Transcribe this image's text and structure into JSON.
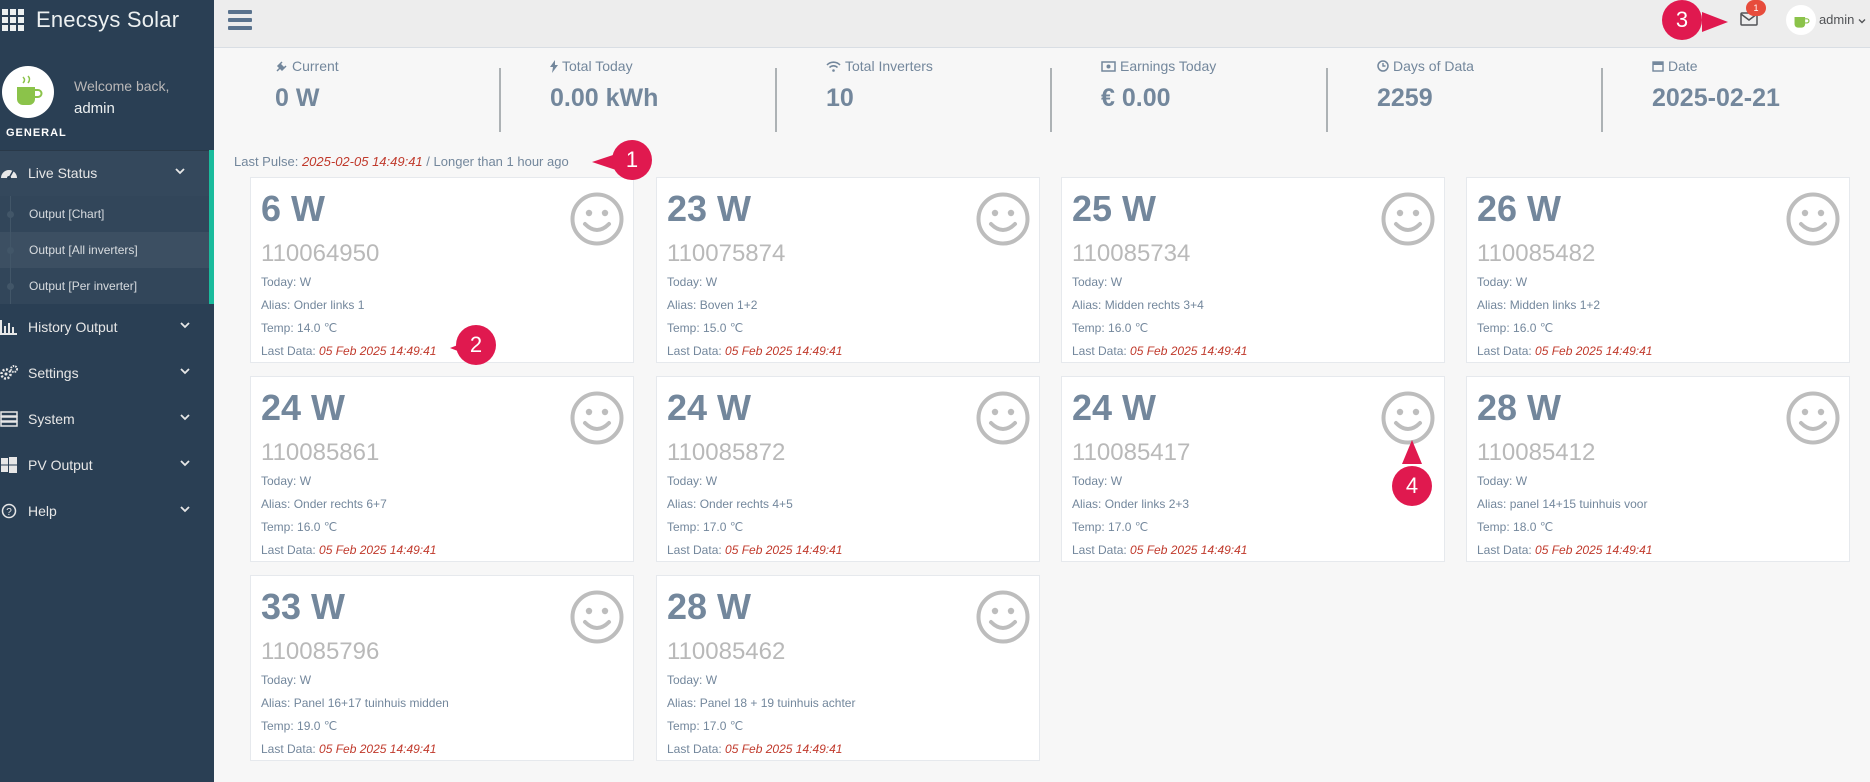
{
  "app": {
    "title": "Enecsys Solar"
  },
  "profile": {
    "welcome": "Welcome back,",
    "username": "admin",
    "section": "GENERAL"
  },
  "menu": {
    "live_status": "Live Status",
    "sub": [
      "Output [Chart]",
      "Output [All inverters]",
      "Output [Per inverter]"
    ],
    "history_output": "History Output",
    "settings": "Settings",
    "system": "System",
    "pv_output": "PV Output",
    "help": "Help"
  },
  "topbar": {
    "mail_badge": "1",
    "user": "admin"
  },
  "stats": [
    {
      "label": "Current",
      "value": "0 W",
      "icon": "plug-icon"
    },
    {
      "label": "Total Today",
      "value": "0.00 kWh",
      "icon": "bolt-icon"
    },
    {
      "label": "Total Inverters",
      "value": "10",
      "icon": "wifi-icon"
    },
    {
      "label": "Earnings Today",
      "value": "€ 0.00",
      "icon": "money-icon"
    },
    {
      "label": "Days of Data",
      "value": "2259",
      "icon": "clock-icon"
    },
    {
      "label": "Date",
      "value": "2025-02-21",
      "icon": "calendar-icon"
    }
  ],
  "pulse": {
    "prefix": "Last Pulse:",
    "timestamp": "2025-02-05 14:49:41",
    "suffix": "/ Longer than 1 hour ago"
  },
  "card_labels": {
    "today": "Today: W",
    "alias": "Alias:",
    "temp": "Temp:",
    "last_data": "Last Data:"
  },
  "inverters": [
    {
      "power": "6 W",
      "serial": "110064950",
      "alias": "Onder links 1",
      "temp": "14.0 ℃",
      "last_data": "05 Feb 2025 14:49:41"
    },
    {
      "power": "23 W",
      "serial": "110075874",
      "alias": "Boven 1+2",
      "temp": "15.0 ℃",
      "last_data": "05 Feb 2025 14:49:41"
    },
    {
      "power": "25 W",
      "serial": "110085734",
      "alias": "Midden rechts 3+4",
      "temp": "16.0 ℃",
      "last_data": "05 Feb 2025 14:49:41"
    },
    {
      "power": "26 W",
      "serial": "110085482",
      "alias": "Midden links 1+2",
      "temp": "16.0 ℃",
      "last_data": "05 Feb 2025 14:49:41"
    },
    {
      "power": "24 W",
      "serial": "110085861",
      "alias": "Onder rechts 6+7",
      "temp": "16.0 ℃",
      "last_data": "05 Feb 2025 14:49:41"
    },
    {
      "power": "24 W",
      "serial": "110085872",
      "alias": "Onder rechts 4+5",
      "temp": "17.0 ℃",
      "last_data": "05 Feb 2025 14:49:41"
    },
    {
      "power": "24 W",
      "serial": "110085417",
      "alias": "Onder links 2+3",
      "temp": "17.0 ℃",
      "last_data": "05 Feb 2025 14:49:41"
    },
    {
      "power": "28 W",
      "serial": "110085412",
      "alias": "panel 14+15 tuinhuis voor",
      "temp": "18.0 ℃",
      "last_data": "05 Feb 2025 14:49:41"
    },
    {
      "power": "33 W",
      "serial": "110085796",
      "alias": "Panel 16+17 tuinhuis midden",
      "temp": "19.0 ℃",
      "last_data": "05 Feb 2025 14:49:41"
    },
    {
      "power": "28 W",
      "serial": "110085462",
      "alias": "Panel 18 + 19 tuinhuis achter",
      "temp": "17.0 ℃",
      "last_data": "05 Feb 2025 14:49:41"
    }
  ],
  "callouts": [
    "1",
    "2",
    "3",
    "4"
  ]
}
